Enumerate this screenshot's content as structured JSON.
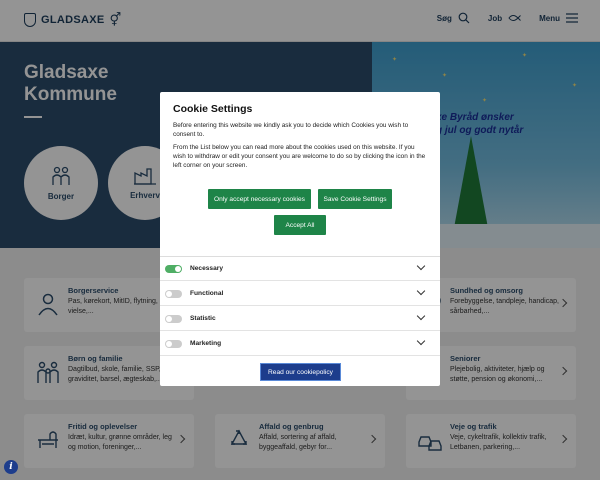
{
  "header": {
    "logo_text": "GLADSAXE",
    "nav": [
      {
        "label": "Søg",
        "icon": "search-icon"
      },
      {
        "label": "Job",
        "icon": "fish-icon"
      },
      {
        "label": "Menu",
        "icon": "hamburger-icon"
      }
    ]
  },
  "hero": {
    "title": "Gladsaxe Kommune",
    "circles": [
      {
        "label": "Borger",
        "icon": "people-icon"
      },
      {
        "label": "Erhverv",
        "icon": "factory-icon"
      }
    ],
    "image_text_line1": "xe Byråd ønsker",
    "image_text_line2": "g jul og godt nytår"
  },
  "cards": [
    {
      "title": "Borgerservice",
      "desc": "Pas, kørekort, MitID, flytning, læge, vielse,...",
      "icon": "person-icon"
    },
    {
      "title": "Sundhed og omsorg",
      "desc": "Forebyggelse, tandpleje, handicap, sårbarhed,...",
      "icon": "health-icon"
    },
    {
      "title": "Børn og familie",
      "desc": "Dagtilbud, skole, familie, SSP, graviditet, barsel, ægteskab,...",
      "icon": "family-icon"
    },
    {
      "title": "Seniorer",
      "desc": "Plejebolig, aktiviteter, hjælp og støtte, pension og økonomi,...",
      "icon": "senior-icon"
    },
    {
      "title": "Fritid og oplevelser",
      "desc": "Idræt, kultur, grønne områder, leg og motion, foreninger,...",
      "icon": "bench-icon"
    },
    {
      "title": "Affald og genbrug",
      "desc": "Affald, sortering af affald, byggeaffald, gebyr for...",
      "icon": "recycle-icon"
    },
    {
      "title": "Veje og trafik",
      "desc": "Veje, cykeltrafik, kollektiv trafik, Letbanen, parkering,...",
      "icon": "cars-icon"
    }
  ],
  "cookie": {
    "title": "Cookie Settings",
    "p1": "Before entering this website we kindly ask you to decide which Cookies you wish to consent to.",
    "p2": "From the List below you can read more about the cookies used on this website. If you wish to withdraw or edit your consent you are welcome to do so by clicking the icon in the left corner on your screen.",
    "btn_necessary": "Only accept necessary cookies",
    "btn_save": "Save Cookie Settings",
    "btn_accept": "Accept All",
    "categories": [
      {
        "label": "Necessary",
        "enabled": true
      },
      {
        "label": "Functional",
        "enabled": false
      },
      {
        "label": "Statistic",
        "enabled": false
      },
      {
        "label": "Marketing",
        "enabled": false
      }
    ],
    "policy": "Read our cookiepolicy"
  },
  "colors": {
    "brand_navy": "#2c4d6c",
    "accept_green": "#1e8448",
    "policy_blue": "#1d3d8c",
    "toggle_on": "#4fae65"
  }
}
